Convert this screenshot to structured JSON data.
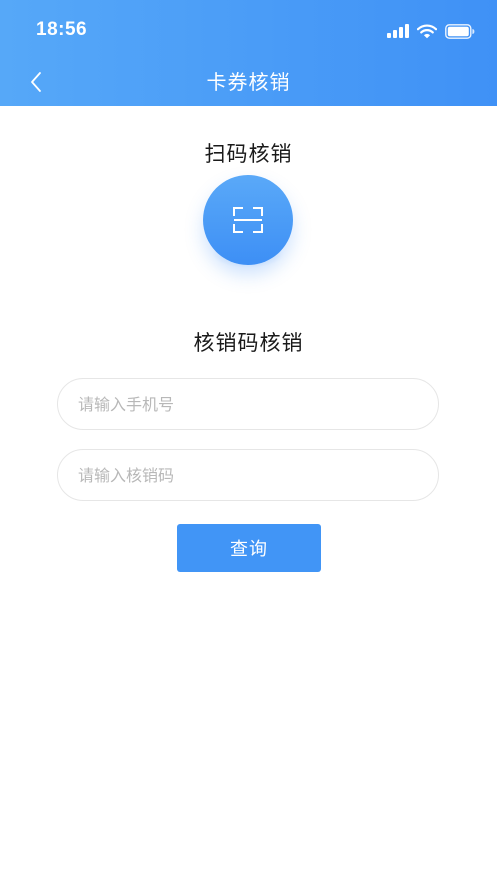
{
  "status_bar": {
    "time": "18:56",
    "icons": [
      "signal-icon",
      "wifi-icon",
      "battery-icon"
    ]
  },
  "nav": {
    "back_icon": "chevron-left-icon",
    "title": "卡券核销"
  },
  "scan": {
    "title": "扫码核销",
    "icon": "scan-frame-icon"
  },
  "code": {
    "title": "核销码核销",
    "phone_placeholder": "请输入手机号",
    "phone_value": "",
    "code_placeholder": "请输入核销码",
    "code_value": "",
    "query_label": "查询"
  },
  "colors": {
    "primary": "#4195f6",
    "header_start": "#56a8f8",
    "header_end": "#3f91f6",
    "placeholder": "#b8b8b8",
    "field_border": "#e6e6e6"
  }
}
